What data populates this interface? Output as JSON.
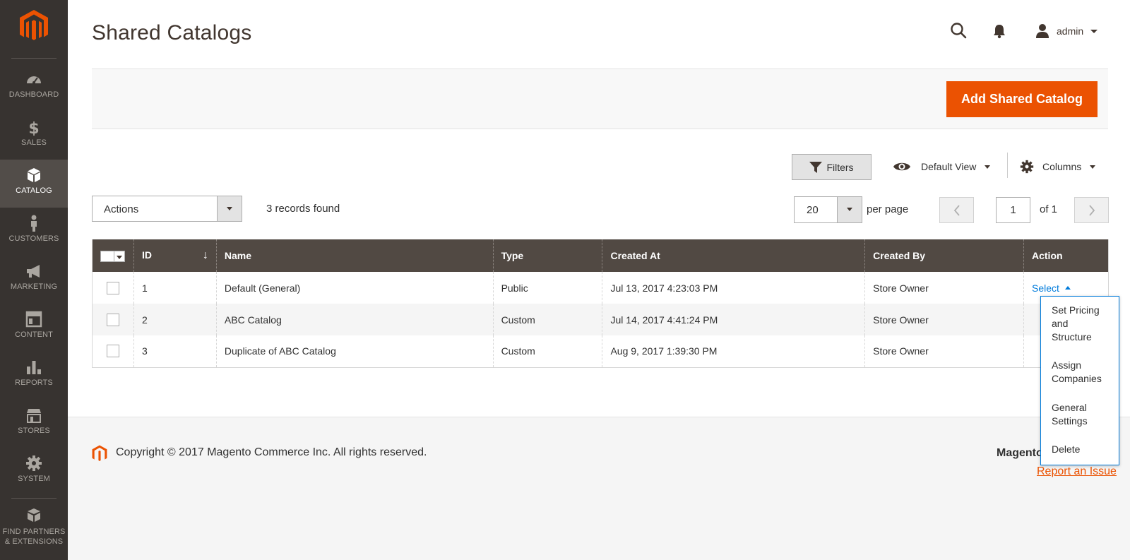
{
  "sidebar": {
    "logo": "magento-logo",
    "items": [
      {
        "label": "DASHBOARD",
        "icon": "dashboard-icon"
      },
      {
        "label": "SALES",
        "icon": "dollar-icon"
      },
      {
        "label": "CATALOG",
        "icon": "box-icon",
        "active": true
      },
      {
        "label": "CUSTOMERS",
        "icon": "person-icon"
      },
      {
        "label": "MARKETING",
        "icon": "megaphone-icon"
      },
      {
        "label": "CONTENT",
        "icon": "layout-icon"
      },
      {
        "label": "REPORTS",
        "icon": "bar-chart-icon"
      },
      {
        "label": "STORES",
        "icon": "storefront-icon"
      },
      {
        "label": "SYSTEM",
        "icon": "gear-icon"
      },
      {
        "label_line1": "FIND PARTNERS",
        "label_line2": "& EXTENSIONS",
        "icon": "cubes-icon"
      }
    ]
  },
  "header": {
    "title": "Shared Catalogs",
    "user": "admin"
  },
  "page_actions": {
    "add_label": "Add Shared Catalog"
  },
  "toolbar": {
    "filters_label": "Filters",
    "view_label": "Default View",
    "columns_label": "Columns",
    "actions_label": "Actions",
    "records_found": "3 records found",
    "per_page_value": "20",
    "per_page_label": "per page",
    "page_value": "1",
    "page_of": "of 1"
  },
  "grid": {
    "columns": [
      "ID",
      "Name",
      "Type",
      "Created At",
      "Created By",
      "Action"
    ],
    "sort_indicator": "↓",
    "rows": [
      {
        "id": "1",
        "name": "Default (General)",
        "type": "Public",
        "created_at": "Jul 13, 2017 4:23:03 PM",
        "created_by": "Store Owner",
        "action": "Select"
      },
      {
        "id": "2",
        "name": "ABC Catalog",
        "type": "Custom",
        "created_at": "Jul 14, 2017 4:41:24 PM",
        "created_by": "Store Owner"
      },
      {
        "id": "3",
        "name": "Duplicate of ABC Catalog",
        "type": "Custom",
        "created_at": "Aug 9, 2017 1:39:30 PM",
        "created_by": "Store Owner"
      }
    ]
  },
  "action_menu": {
    "items": [
      {
        "line1": "Set Pricing",
        "line2": "and",
        "line3": "Structure"
      },
      {
        "line1": "Assign",
        "line2": "Companies"
      },
      {
        "line1": "General",
        "line2": "Settings"
      },
      {
        "line1": "Delete"
      }
    ]
  },
  "footer": {
    "copyright": "Copyright © 2017 Magento Commerce Inc. All rights reserved.",
    "brand": "Magento",
    "report": "Report an Issue"
  },
  "colors": {
    "sidebar_bg": "#373330",
    "sidebar_active": "#524d49",
    "accent": "#eb5202",
    "table_header": "#514943",
    "link": "#007bdb"
  }
}
